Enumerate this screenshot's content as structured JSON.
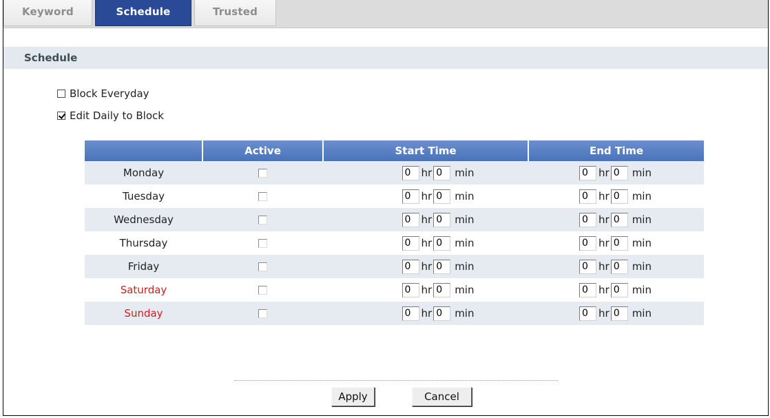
{
  "tabs": [
    {
      "label": "Keyword",
      "active": false
    },
    {
      "label": "Schedule",
      "active": true
    },
    {
      "label": "Trusted",
      "active": false
    }
  ],
  "section_title": "Schedule",
  "options": {
    "block_everyday": {
      "label": "Block Everyday",
      "checked": false
    },
    "edit_daily": {
      "label": "Edit Daily to Block",
      "checked": true
    }
  },
  "table": {
    "headers": [
      "",
      "Active",
      "Start Time",
      "End Time"
    ],
    "hr_label": "hr",
    "min_label": "min",
    "rows": [
      {
        "day": "Monday",
        "active": false,
        "start_hr": "0",
        "start_min": "0",
        "end_hr": "0",
        "end_min": "0"
      },
      {
        "day": "Tuesday",
        "active": false,
        "start_hr": "0",
        "start_min": "0",
        "end_hr": "0",
        "end_min": "0"
      },
      {
        "day": "Wednesday",
        "active": false,
        "start_hr": "0",
        "start_min": "0",
        "end_hr": "0",
        "end_min": "0"
      },
      {
        "day": "Thursday",
        "active": false,
        "start_hr": "0",
        "start_min": "0",
        "end_hr": "0",
        "end_min": "0"
      },
      {
        "day": "Friday",
        "active": false,
        "start_hr": "0",
        "start_min": "0",
        "end_hr": "0",
        "end_min": "0"
      },
      {
        "day": "Saturday",
        "active": false,
        "start_hr": "0",
        "start_min": "0",
        "end_hr": "0",
        "end_min": "0"
      },
      {
        "day": "Sunday",
        "active": false,
        "start_hr": "0",
        "start_min": "0",
        "end_hr": "0",
        "end_min": "0"
      }
    ]
  },
  "buttons": {
    "apply": "Apply",
    "cancel": "Cancel"
  },
  "colors": {
    "tab_active": "#2a4a98",
    "header_blue": "#5a80c4",
    "weekend_red": "#cc1f1f",
    "row_alt": "#e6ebf1"
  }
}
